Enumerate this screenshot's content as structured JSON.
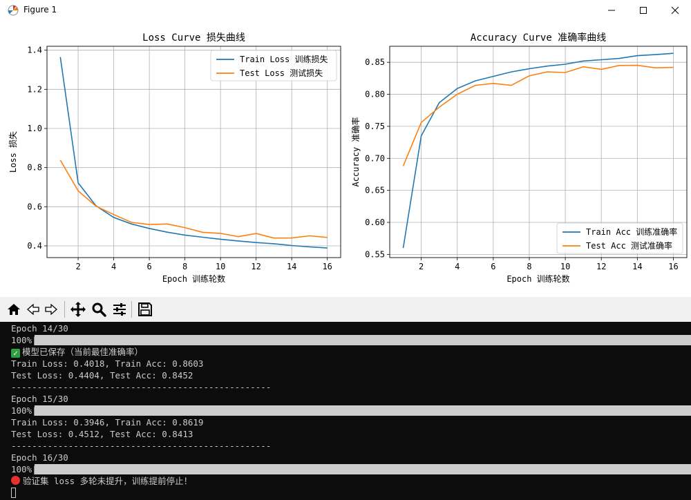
{
  "window": {
    "title": "Figure 1",
    "controls": {
      "minimize": "minimize-icon",
      "maximize": "maximize-icon",
      "close": "close-icon"
    }
  },
  "colors": {
    "train": "#1f77b4",
    "test": "#ff7f0e",
    "grid": "#b0b0b0",
    "terminal_bg": "#0c0c0c",
    "terminal_fg": "#cccccc"
  },
  "chart_data": [
    {
      "type": "line",
      "title": "Loss Curve 损失曲线",
      "xlabel": "Epoch 训练轮数",
      "ylabel": "Loss 损失",
      "x": [
        1,
        2,
        3,
        4,
        5,
        6,
        7,
        8,
        9,
        10,
        11,
        12,
        13,
        14,
        15,
        16
      ],
      "xlim": [
        0.25,
        16.75
      ],
      "ylim": [
        0.34,
        1.42
      ],
      "xticks": [
        2,
        4,
        6,
        8,
        10,
        12,
        14,
        16
      ],
      "yticks": [
        0.4,
        0.6,
        0.8,
        1.0,
        1.2,
        1.4
      ],
      "ytick_labels": [
        "0.4",
        "0.6",
        "0.8",
        "1.0",
        "1.2",
        "1.4"
      ],
      "grid": true,
      "legend": "top-right",
      "series": [
        {
          "name": "Train Loss 训练损失",
          "color": "#1f77b4",
          "values": [
            1.365,
            0.722,
            0.605,
            0.545,
            0.512,
            0.489,
            0.47,
            0.455,
            0.444,
            0.434,
            0.425,
            0.417,
            0.411,
            0.4018,
            0.3946,
            0.389
          ]
        },
        {
          "name": "Test Loss 测试损失",
          "color": "#ff7f0e",
          "values": [
            0.838,
            0.681,
            0.603,
            0.56,
            0.52,
            0.509,
            0.512,
            0.493,
            0.469,
            0.464,
            0.447,
            0.463,
            0.44,
            0.4404,
            0.4512,
            0.443
          ]
        }
      ]
    },
    {
      "type": "line",
      "title": "Accuracy Curve 准确率曲线",
      "xlabel": "Epoch 训练轮数",
      "ylabel": "Accuracy 准确率",
      "x": [
        1,
        2,
        3,
        4,
        5,
        6,
        7,
        8,
        9,
        10,
        11,
        12,
        13,
        14,
        15,
        16
      ],
      "xlim": [
        0.25,
        16.75
      ],
      "ylim": [
        0.545,
        0.875
      ],
      "xticks": [
        2,
        4,
        6,
        8,
        10,
        12,
        14,
        16
      ],
      "yticks": [
        0.55,
        0.6,
        0.65,
        0.7,
        0.75,
        0.8,
        0.85
      ],
      "ytick_labels": [
        "0.55",
        "0.60",
        "0.65",
        "0.70",
        "0.75",
        "0.80",
        "0.85"
      ],
      "grid": true,
      "legend": "bottom-right",
      "series": [
        {
          "name": "Train Acc 训练准确率",
          "color": "#1f77b4",
          "values": [
            0.56,
            0.735,
            0.787,
            0.809,
            0.821,
            0.828,
            0.835,
            0.84,
            0.844,
            0.847,
            0.852,
            0.854,
            0.856,
            0.8603,
            0.8619,
            0.864
          ]
        },
        {
          "name": "Test Acc 测试准确率",
          "color": "#ff7f0e",
          "values": [
            0.688,
            0.756,
            0.78,
            0.8,
            0.814,
            0.817,
            0.814,
            0.829,
            0.835,
            0.834,
            0.843,
            0.839,
            0.845,
            0.8452,
            0.8413,
            0.842
          ]
        }
      ]
    }
  ],
  "toolbar": {
    "buttons": [
      "home-icon",
      "back-icon",
      "forward-icon",
      "pan-icon",
      "zoom-icon",
      "configure-subplots-icon",
      "save-icon"
    ]
  },
  "terminal": {
    "lines": [
      {
        "kind": "text",
        "text": "Epoch 14/30"
      },
      {
        "kind": "progress",
        "text": "100%|",
        "fraction": 1.0
      },
      {
        "kind": "check",
        "text": "模型已保存（当前最佳准确率）"
      },
      {
        "kind": "text",
        "text": "Train Loss: 0.4018, Train Acc: 0.8603"
      },
      {
        "kind": "text",
        "text": "Test Loss: 0.4404, Test Acc: 0.8452"
      },
      {
        "kind": "text",
        "text": "--------------------------------------------------"
      },
      {
        "kind": "text",
        "text": "Epoch 15/30"
      },
      {
        "kind": "progress",
        "text": "100%|",
        "fraction": 1.0
      },
      {
        "kind": "text",
        "text": "Train Loss: 0.3946, Train Acc: 0.8619"
      },
      {
        "kind": "text",
        "text": "Test Loss: 0.4512, Test Acc: 0.8413"
      },
      {
        "kind": "text",
        "text": "--------------------------------------------------"
      },
      {
        "kind": "text",
        "text": "Epoch 16/30"
      },
      {
        "kind": "progress",
        "text": "100%|",
        "fraction": 1.0
      },
      {
        "kind": "stop",
        "text": "验证集 loss 多轮未提升，训练提前停止！"
      }
    ]
  }
}
